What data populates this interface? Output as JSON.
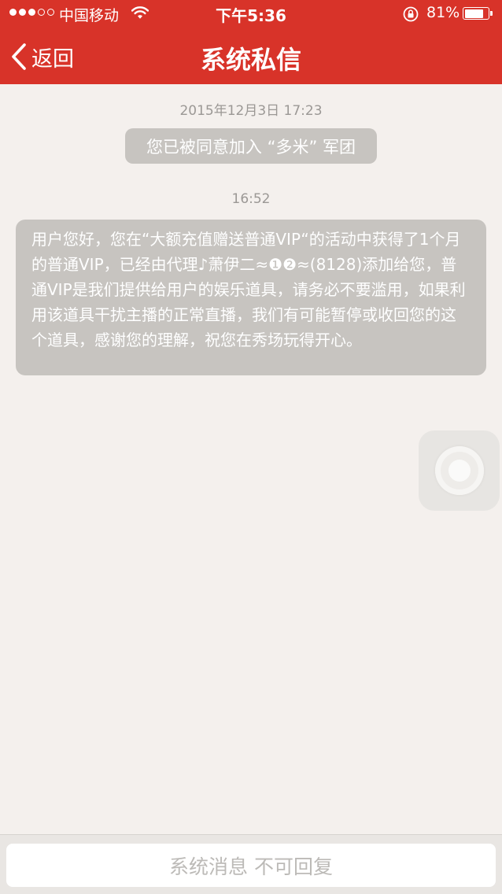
{
  "status_bar": {
    "carrier": "中国移动",
    "time": "下午5:36",
    "battery_percent": "81%",
    "battery_level": 0.81,
    "signal_bars_filled": 3,
    "signal_bars_total": 5
  },
  "nav": {
    "back_label": "返回",
    "title": "系统私信",
    "background_color": "#d83329"
  },
  "messages": [
    {
      "timestamp": "2015年12月3日 17:23",
      "text": "您已被同意加入 “多米” 军团"
    },
    {
      "timestamp": "16:52",
      "text": "用户您好，您在“大额充值赠送普通VIP“的活动中获得了1个月的普通VIP，已经由代理♪萧伊二≈❶❷≈(8128)添加给您，普通VIP是我们提供给用户的娱乐道具，请务必不要滥用，如果利用该道具干扰主播的正常直播，我们有可能暂停或收回您的这个道具，感谢您的理解，祝您在秀场玩得开心。"
    }
  ],
  "footer": {
    "placeholder": "系统消息 不可回复"
  },
  "icons": {
    "back": "chevron-left-icon",
    "wifi": "wifi-icon",
    "rotation_lock": "rotation-lock-icon",
    "battery": "battery-icon",
    "assistive_touch": "assistive-touch-icon"
  }
}
